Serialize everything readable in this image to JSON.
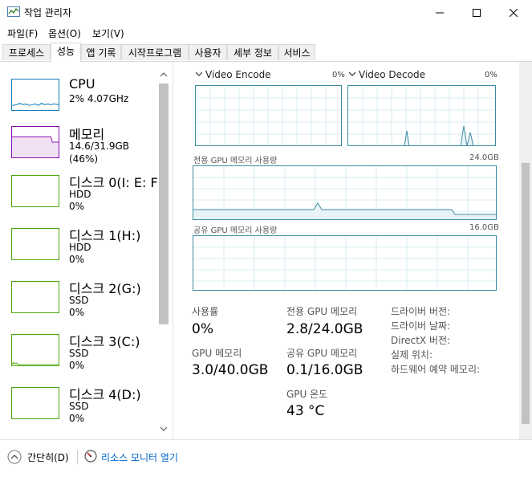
{
  "window": {
    "title": "작업 관리자"
  },
  "menu": [
    "파일(F)",
    "옵션(O)",
    "보기(V)"
  ],
  "tabs": [
    "프로세스",
    "성능",
    "앱 기록",
    "시작프로그램",
    "사용자",
    "세부 정보",
    "서비스"
  ],
  "active_tab": "성능",
  "sidebar": [
    {
      "title": "CPU",
      "lines": [
        "2%  4.07GHz"
      ],
      "color": "#117dbb"
    },
    {
      "title": "메모리",
      "lines": [
        "14.6/31.9GB (46%)"
      ],
      "color": "#8b12ae"
    },
    {
      "title": "디스크 0(I: E: F:",
      "lines": [
        "HDD",
        "0%"
      ],
      "color": "#4da60c"
    },
    {
      "title": "디스크 1(H:)",
      "lines": [
        "HDD",
        "0%"
      ],
      "color": "#4da60c"
    },
    {
      "title": "디스크 2(G:)",
      "lines": [
        "SSD",
        "0%"
      ],
      "color": "#4da60c"
    },
    {
      "title": "디스크 3(C:)",
      "lines": [
        "SSD",
        "0%"
      ],
      "color": "#4da60c"
    },
    {
      "title": "디스크 4(D:)",
      "lines": [
        "SSD",
        "0%"
      ],
      "color": "#4da60c"
    }
  ],
  "gpu": {
    "encode": {
      "label": "Video Encode",
      "pct": "0%"
    },
    "decode": {
      "label": "Video Decode",
      "pct": "0%"
    },
    "dedicated_graph": {
      "label": "전용 GPU 메모리 사용량",
      "max": "24.0GB"
    },
    "shared_graph": {
      "label": "공유 GPU 메모리 사용량",
      "max": "16.0GB"
    },
    "stats": {
      "usage_label": "사용률",
      "usage_val": "0%",
      "dedicated_label": "전용 GPU 메모리",
      "dedicated_val": "2.8/24.0GB",
      "gpumem_label": "GPU 메모리",
      "gpumem_val": "3.0/40.0GB",
      "shared_label": "공유 GPU 메모리",
      "shared_val": "0.1/16.0GB",
      "temp_label": "GPU 온도",
      "temp_val": "43 °C"
    },
    "info_labels": [
      "드라이버 버전:",
      "드라이버 날짜:",
      "DirectX 버전:",
      "실제 위치:",
      "하드웨어 예약 메모리:"
    ]
  },
  "footer": {
    "brief": "간단히(D)",
    "monitor": "리소스 모니터 열기"
  },
  "colors": {
    "gpu_graph": "#3c8ca3",
    "link": "#0066cc"
  }
}
